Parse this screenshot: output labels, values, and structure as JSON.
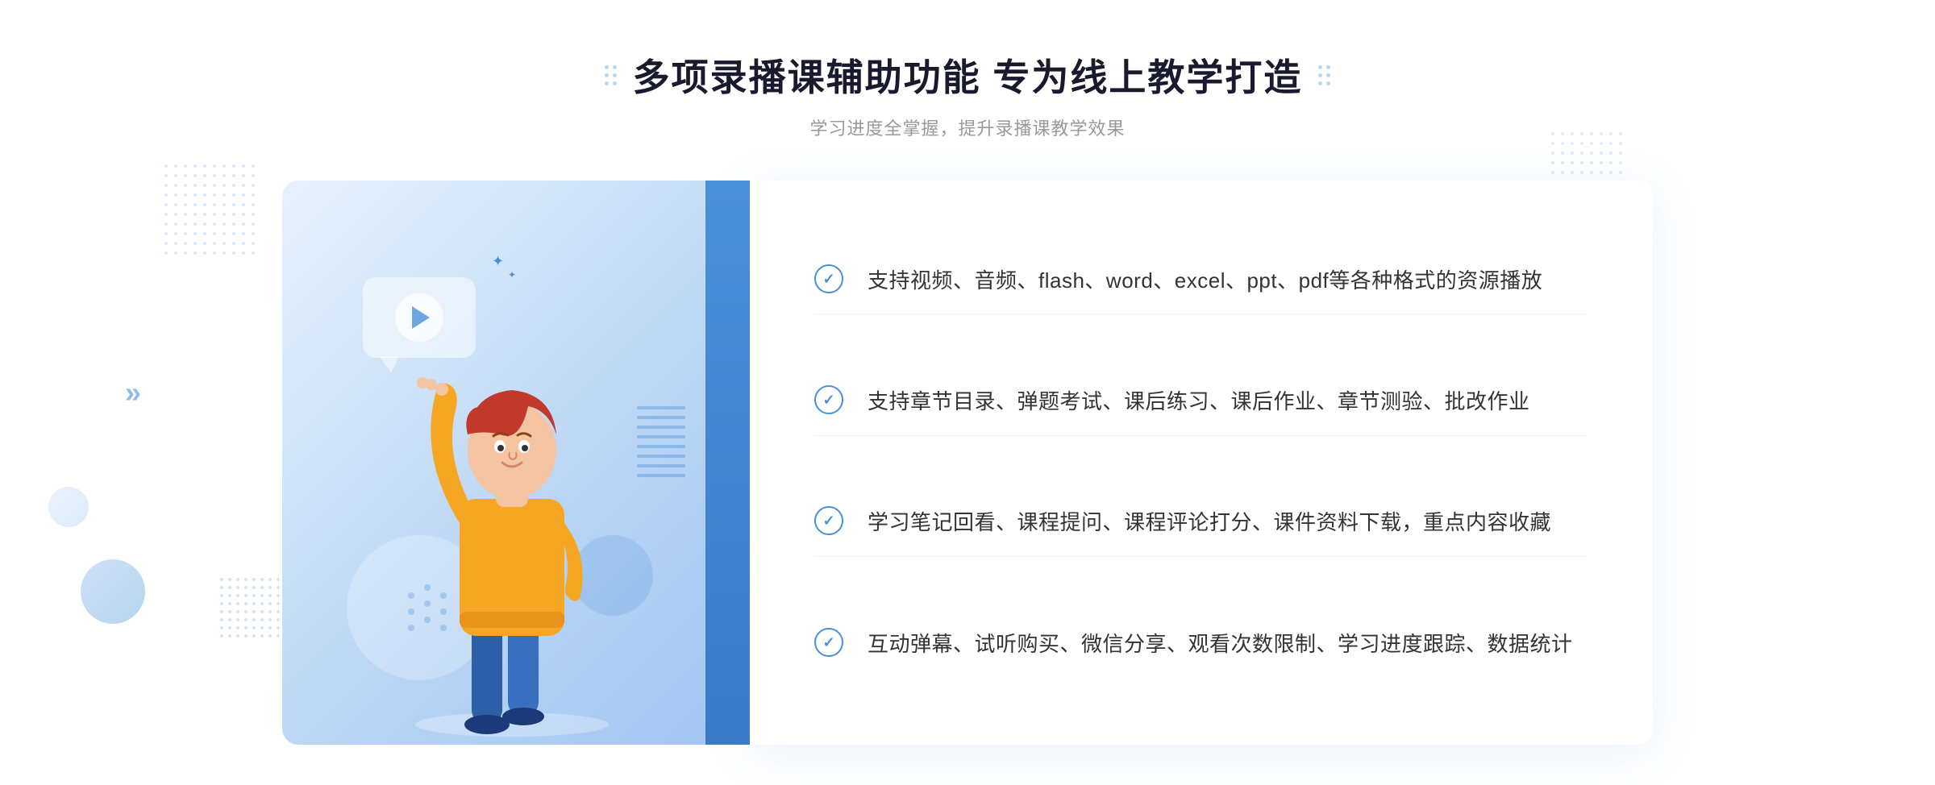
{
  "header": {
    "title": "多项录播课辅助功能 专为线上教学打造",
    "subtitle": "学习进度全掌握，提升录播课教学效果"
  },
  "features": [
    {
      "id": "feature-1",
      "text": "支持视频、音频、flash、word、excel、ppt、pdf等各种格式的资源播放"
    },
    {
      "id": "feature-2",
      "text": "支持章节目录、弹题考试、课后练习、课后作业、章节测验、批改作业"
    },
    {
      "id": "feature-3",
      "text": "学习笔记回看、课程提问、课程评论打分、课件资料下载，重点内容收藏"
    },
    {
      "id": "feature-4",
      "text": "互动弹幕、试听购买、微信分享、观看次数限制、学习进度跟踪、数据统计"
    }
  ],
  "decorations": {
    "arrow_left": "»",
    "check_mark": "✓"
  }
}
